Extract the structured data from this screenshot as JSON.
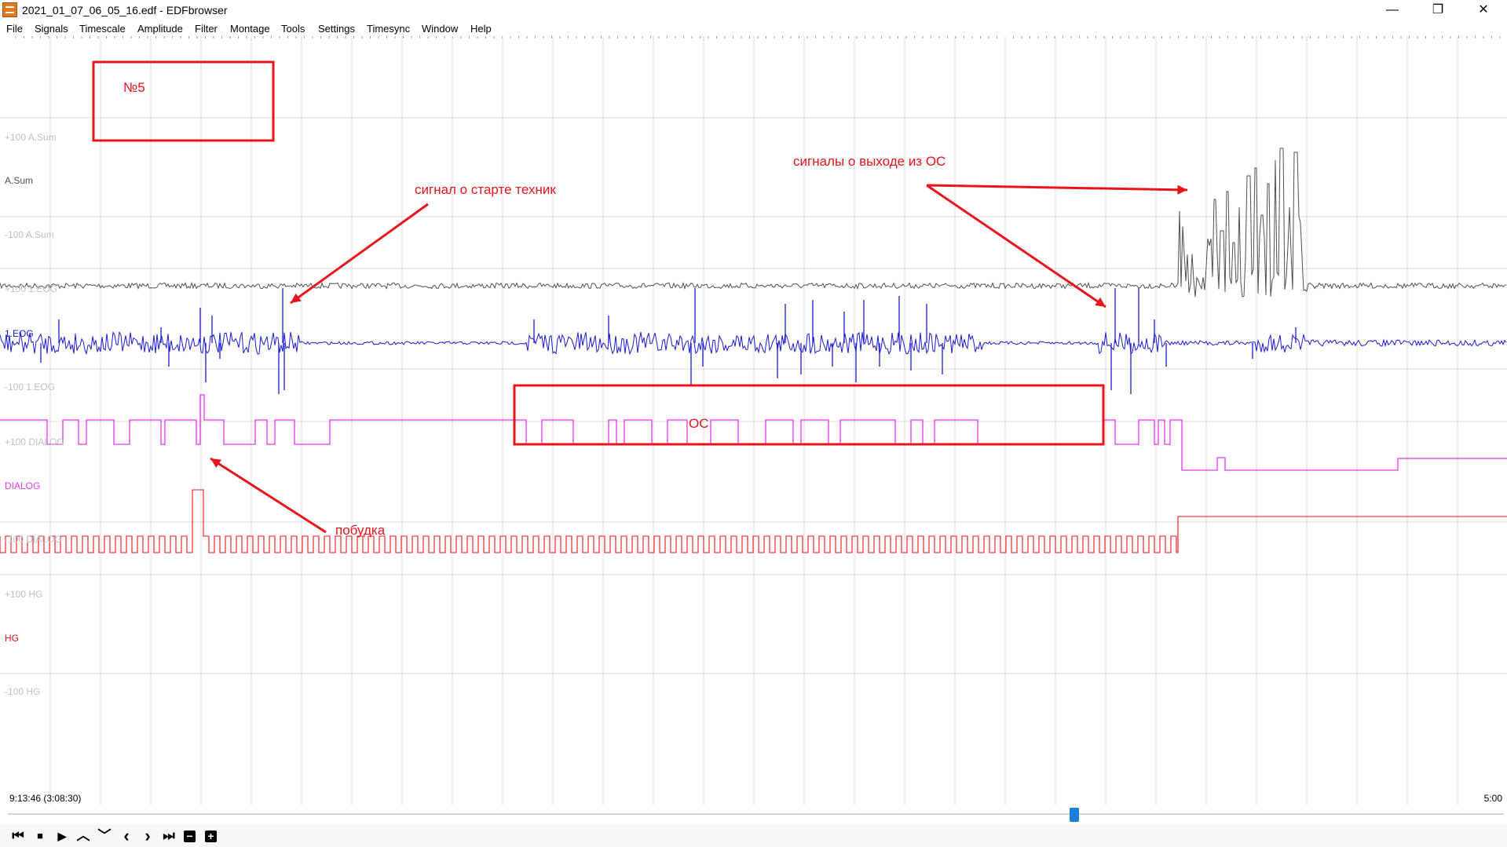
{
  "window": {
    "title": "2021_01_07_06_05_16.edf - EDFbrowser",
    "minimize": "—",
    "maximize": "❐",
    "close": "✕"
  },
  "menu": [
    "File",
    "Signals",
    "Timescale",
    "Amplitude",
    "Filter",
    "Montage",
    "Tools",
    "Settings",
    "Timesync",
    "Window",
    "Help"
  ],
  "signals": [
    {
      "name": "A.Sum",
      "top": "+100 A.Sum",
      "bottom": "-100 A.Sum",
      "color": "#505050"
    },
    {
      "name": "1.EOG",
      "top": "+100 1.EOG",
      "bottom": "-100 1.EOG",
      "color": "#1a1ad6"
    },
    {
      "name": "DIALOG",
      "top": "+100 DIALOG",
      "bottom": "-100 DIALOG",
      "color": "#e637e6"
    },
    {
      "name": "HG",
      "top": "+100 HG",
      "bottom": "-100 HG",
      "color": "#e8141c"
    }
  ],
  "annotations": {
    "box_label": "№5",
    "technique_start": "сигнал о старте техник",
    "exit_signals": "сигналы о выходе из ОС",
    "os_label": "ОС",
    "wakeup": "побудка"
  },
  "time": {
    "start": "9:13:46 (3:08:30)",
    "window_length": "5:00"
  },
  "scroll_position": 0.714,
  "toolbar": {
    "first": "⏮",
    "stop": "■",
    "play": "▶",
    "up": "︿",
    "down": "﹀",
    "prev": "‹",
    "next": "›",
    "last": "⏭",
    "minus": "−",
    "plus": "+"
  }
}
